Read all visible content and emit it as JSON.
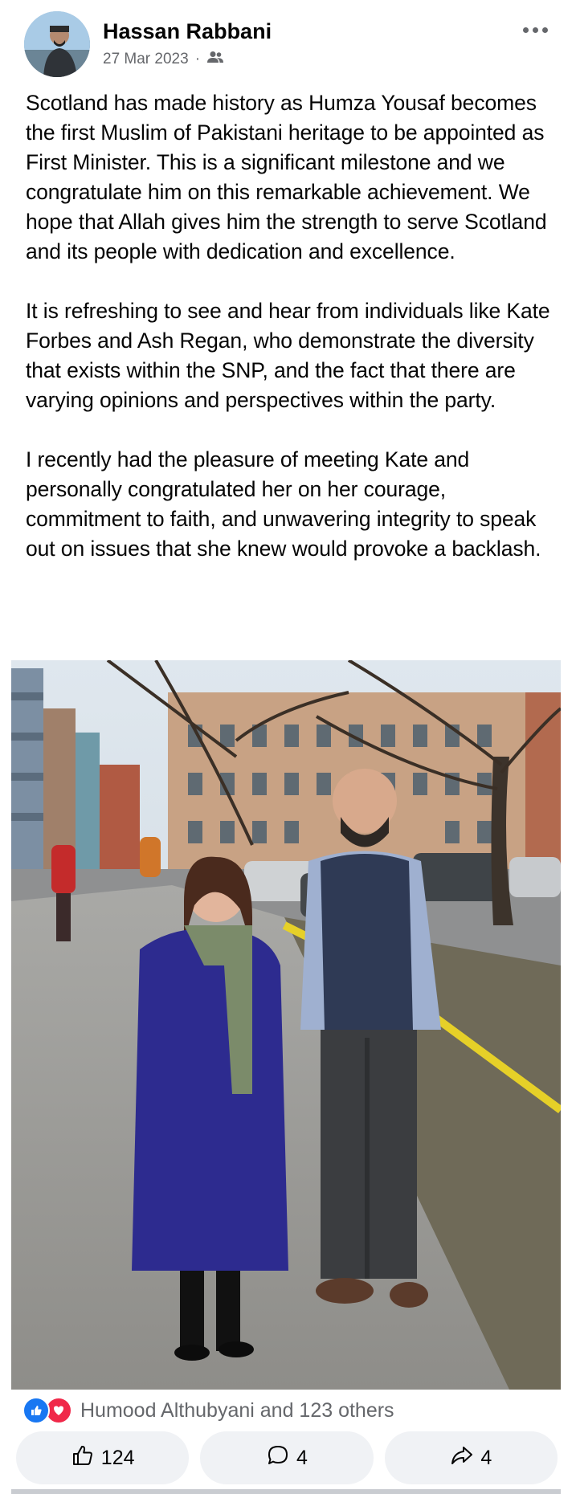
{
  "post": {
    "author": "Hassan Rabbani",
    "date": "27 Mar 2023",
    "separator": "·",
    "audience_icon": "friends-icon",
    "paragraphs": [
      "Scotland has made history as Humza Yousaf becomes the first Muslim of Pakistani heritage to be appointed as First Minister. This is a significant milestone and we congratulate him on this remarkable achievement. We hope that Allah gives him the strength to serve Scotland and its people with dedication and excellence.",
      "It is refreshing to see and hear from individuals like Kate Forbes and Ash Regan, who demonstrate the diversity that exists within the SNP, and the fact that there are varying opinions and perspectives within the party.",
      "I recently had the pleasure of meeting Kate and personally congratulated her on her courage, commitment to faith, and unwavering integrity to speak out on issues that she knew would provoke a backlash."
    ]
  },
  "reactions": {
    "summary": "Humood Althubyani and 123 others",
    "icons": [
      "like-icon",
      "love-icon"
    ]
  },
  "actions": {
    "like_count": "124",
    "comment_count": "4",
    "share_count": "4"
  },
  "colors": {
    "accent": "#1877f2",
    "love": "#f02849",
    "muted_text": "#65676b",
    "button_bg": "#f0f2f5"
  }
}
